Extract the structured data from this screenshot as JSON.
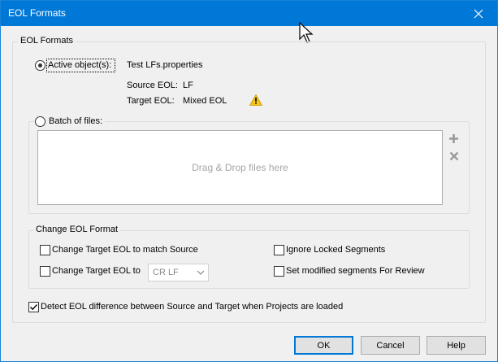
{
  "window": {
    "title": "EOL Formats"
  },
  "formats_group": {
    "legend": "EOL Formats"
  },
  "active": {
    "label": "Active object(s):",
    "value": "Test LFs.properties",
    "source_label": "Source EOL:",
    "source_value": "LF",
    "target_label": "Target EOL:",
    "target_value": "Mixed EOL",
    "checked": true
  },
  "batch": {
    "label": "Batch of files:",
    "drop_hint": "Drag & Drop files here",
    "checked": false
  },
  "change_group": {
    "legend": "Change EOL Format",
    "match_source": "Change Target EOL to match Source",
    "change_to": "Change Target EOL to",
    "eol_select": "CR LF",
    "ignore_locked": "Ignore Locked Segments",
    "set_review": "Set modified segments For Review"
  },
  "detect": {
    "label": "Detect EOL difference between Source and Target when Projects are loaded",
    "checked": true
  },
  "buttons": {
    "ok": "OK",
    "cancel": "Cancel",
    "help": "Help"
  },
  "colors": {
    "titlebar": "#0078d7",
    "warning": "#f6c31b"
  }
}
